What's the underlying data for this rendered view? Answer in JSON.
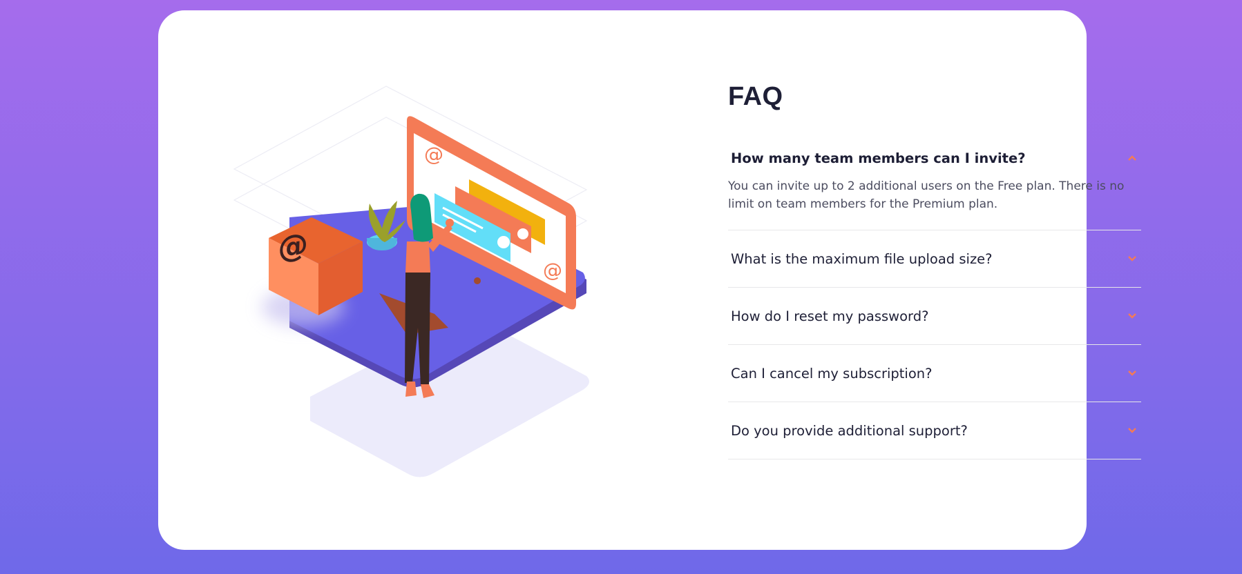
{
  "faq": {
    "title": "FAQ",
    "items": [
      {
        "question": "How many team members can I invite?",
        "answer": "You can invite up to 2 additional users on the Free plan. There is no limit on team members for the Premium plan.",
        "expanded": true
      },
      {
        "question": "What is the maximum file upload size?",
        "expanded": false
      },
      {
        "question": "How do I reset my password?",
        "expanded": false
      },
      {
        "question": "Can I cancel my subscription?",
        "expanded": false
      },
      {
        "question": "Do you provide additional support?",
        "expanded": false
      }
    ]
  },
  "colors": {
    "accent": "#f47b56",
    "background_top": "#a56cec",
    "background_bottom": "#6f69e9",
    "card": "#ffffff",
    "heading": "#1e1f36",
    "text": "#4b4c5f",
    "divider": "#e7e7e9"
  },
  "illustration": {
    "type": "woman-online-illustration",
    "at_symbol": "@"
  }
}
